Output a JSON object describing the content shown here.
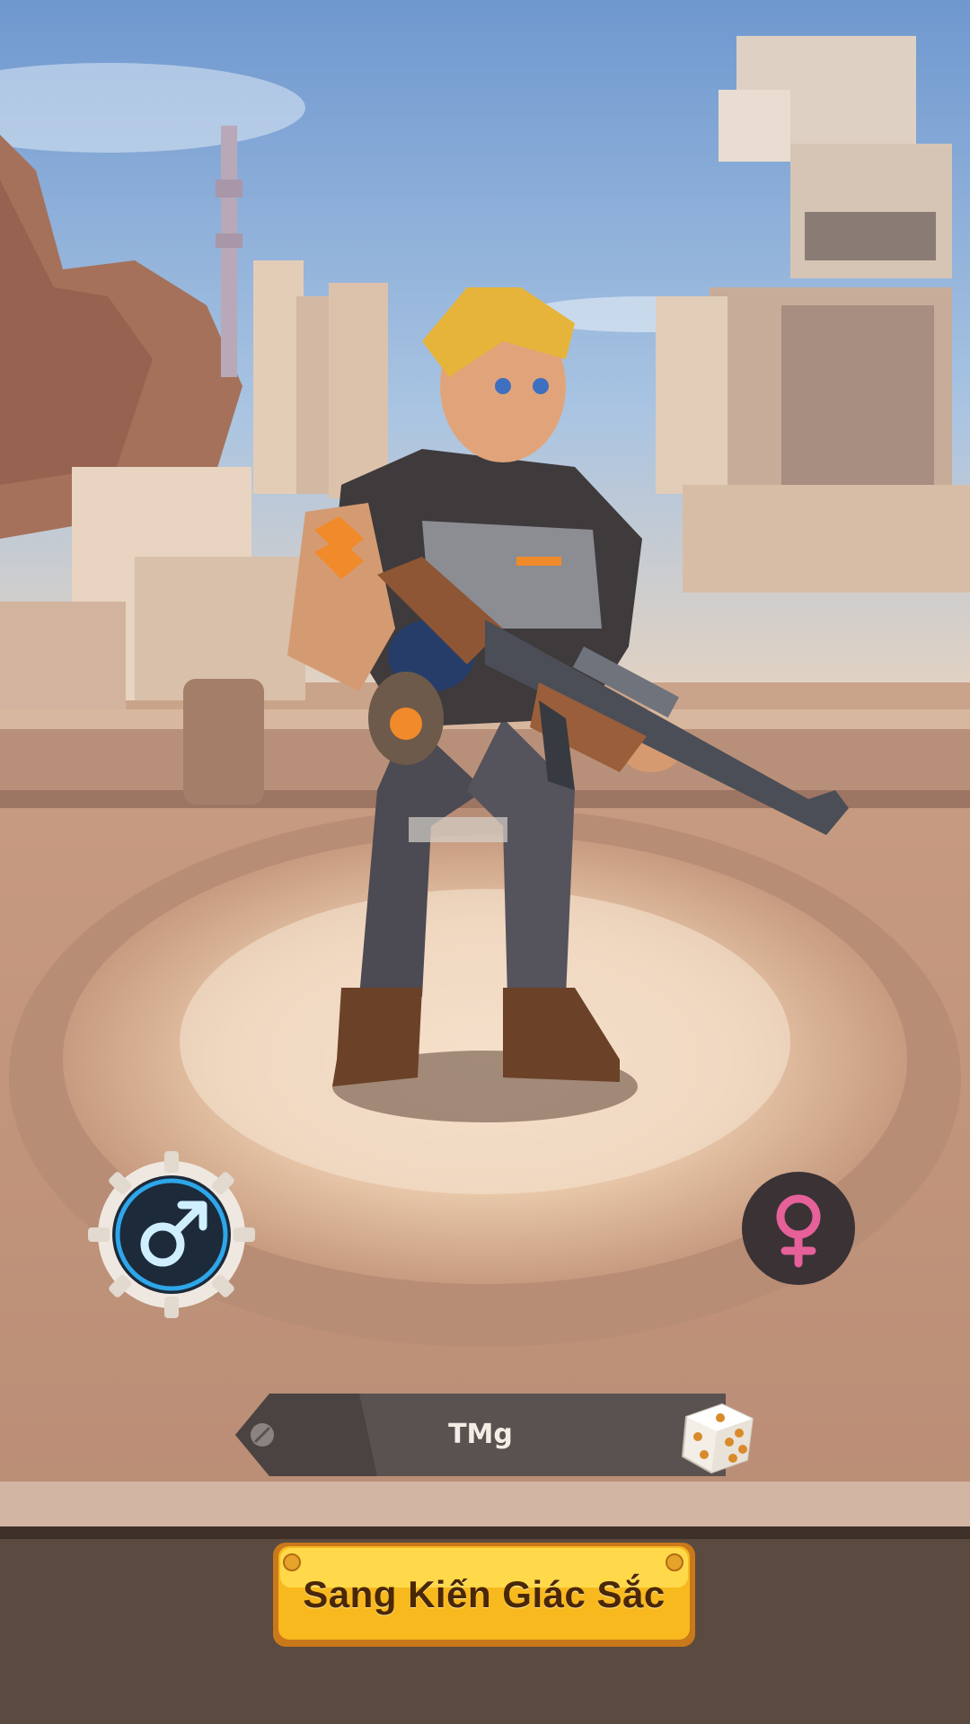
{
  "screen": "character-creation",
  "character": {
    "name": "TMg",
    "selected_gender": "male"
  },
  "gender_options": [
    {
      "id": "male",
      "icon": "male-symbol-icon",
      "selected": true
    },
    {
      "id": "female",
      "icon": "female-symbol-icon",
      "selected": false
    }
  ],
  "name_bar": {
    "random_icon": "dice-icon"
  },
  "confirm_button": {
    "label": "Sang Kiến Giác Sắc"
  },
  "colors": {
    "male_accent": "#2ea6ea",
    "female_accent": "#e6609a",
    "button_yellow": "#f7b91e",
    "button_text": "#4a2708"
  }
}
